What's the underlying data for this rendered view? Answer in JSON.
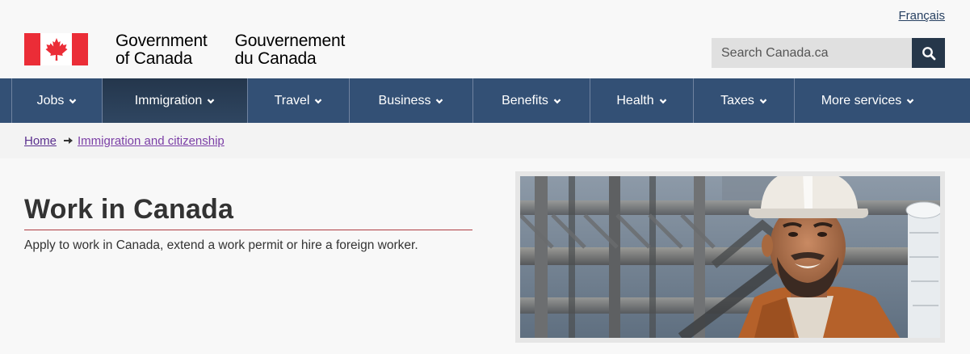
{
  "header": {
    "language_link": "Français",
    "wordmark_en_line1": "Government",
    "wordmark_en_line2": "of Canada",
    "wordmark_fr_line1": "Gouvernement",
    "wordmark_fr_line2": "du Canada",
    "search_placeholder": "Search Canada.ca"
  },
  "nav": {
    "items": [
      {
        "label": "Jobs"
      },
      {
        "label": "Immigration"
      },
      {
        "label": "Travel"
      },
      {
        "label": "Business"
      },
      {
        "label": "Benefits"
      },
      {
        "label": "Health"
      },
      {
        "label": "Taxes"
      },
      {
        "label": "More services"
      }
    ]
  },
  "breadcrumb": {
    "home": "Home",
    "current": "Immigration and citizenship"
  },
  "main": {
    "title": "Work in Canada",
    "lead": "Apply to work in Canada, extend a work permit or hire a foreign worker."
  },
  "colors": {
    "nav_bg": "#335075",
    "flag_red": "#eb2d37",
    "title_rule": "#af3c43",
    "search_button": "#26374a"
  }
}
